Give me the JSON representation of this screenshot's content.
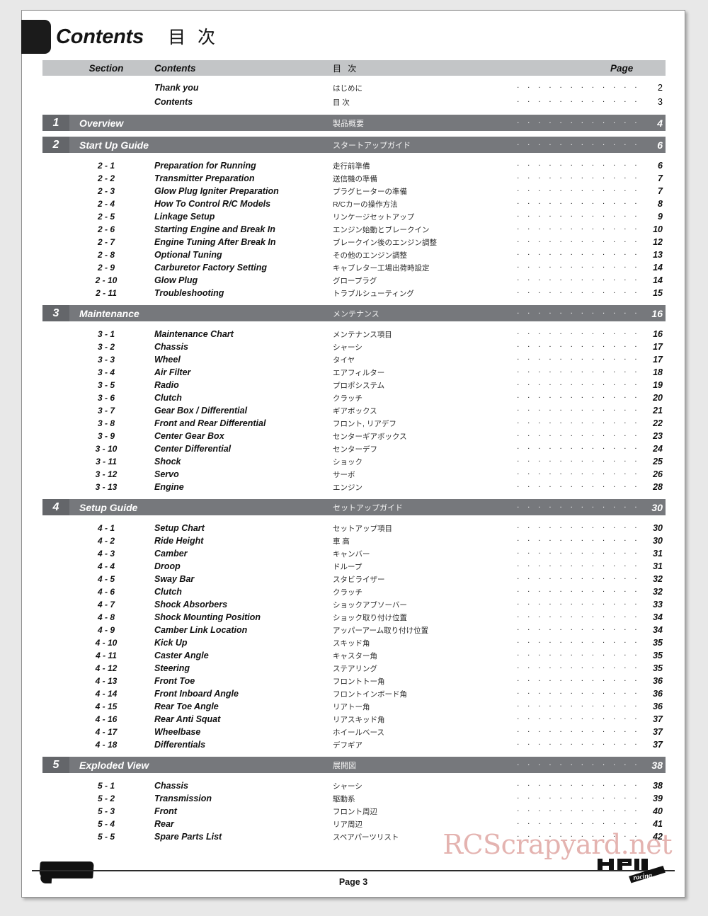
{
  "document": {
    "title_en": "Contents",
    "title_jp": "目 次"
  },
  "table": {
    "headers": {
      "section": "Section",
      "contents": "Contents",
      "contents_jp": "目 次",
      "page": "Page"
    },
    "front_matter": [
      {
        "title": "Thank you",
        "jp": "はじめに",
        "page": "2"
      },
      {
        "title": "Contents",
        "jp": "目 次",
        "page": "3"
      }
    ],
    "sections": [
      {
        "number": "1",
        "title": "Overview",
        "jp": "製品概要",
        "page": "4",
        "items": []
      },
      {
        "number": "2",
        "title": "Start Up Guide",
        "jp": "スタートアップガイド",
        "page": "6",
        "items": [
          {
            "sec": "2 - 1",
            "title": "Preparation for Running",
            "jp": "走行前準備",
            "page": "6"
          },
          {
            "sec": "2 - 2",
            "title": "Transmitter Preparation",
            "jp": "送信機の準備",
            "page": "7"
          },
          {
            "sec": "2 - 3",
            "title": "Glow Plug Igniter Preparation",
            "jp": "プラグヒーターの準備",
            "page": "7"
          },
          {
            "sec": "2 - 4",
            "title": "How To Control R/C Models",
            "jp": "R/Cカーの操作方法",
            "page": "8"
          },
          {
            "sec": "2 - 5",
            "title": "Linkage Setup",
            "jp": "リンケージセットアップ",
            "page": "9"
          },
          {
            "sec": "2 - 6",
            "title": "Starting Engine and Break In",
            "jp": "エンジン始動とブレークイン",
            "page": "10"
          },
          {
            "sec": "2 - 7",
            "title": "Engine Tuning After Break In",
            "jp": "ブレークイン後のエンジン調整",
            "page": "12"
          },
          {
            "sec": "2 - 8",
            "title": "Optional Tuning",
            "jp": "その他のエンジン調整",
            "page": "13"
          },
          {
            "sec": "2 - 9",
            "title": "Carburetor Factory Setting",
            "jp": "キャブレター工場出荷時設定",
            "page": "14"
          },
          {
            "sec": "2 - 10",
            "title": "Glow Plug",
            "jp": "グロープラグ",
            "page": "14"
          },
          {
            "sec": "2 - 11",
            "title": "Troubleshooting",
            "jp": "トラブルシューティング",
            "page": "15"
          }
        ]
      },
      {
        "number": "3",
        "title": "Maintenance",
        "jp": "メンテナンス",
        "page": "16",
        "items": [
          {
            "sec": "3 - 1",
            "title": "Maintenance Chart",
            "jp": "メンテナンス項目",
            "page": "16"
          },
          {
            "sec": "3 - 2",
            "title": "Chassis",
            "jp": "シャーシ",
            "page": "17"
          },
          {
            "sec": "3 - 3",
            "title": "Wheel",
            "jp": "タイヤ",
            "page": "17"
          },
          {
            "sec": "3 - 4",
            "title": "Air Filter",
            "jp": "エアフィルター",
            "page": "18"
          },
          {
            "sec": "3 - 5",
            "title": "Radio",
            "jp": "プロポシステム",
            "page": "19"
          },
          {
            "sec": "3 - 6",
            "title": "Clutch",
            "jp": "クラッチ",
            "page": "20"
          },
          {
            "sec": "3 - 7",
            "title": "Gear Box / Differential",
            "jp": "ギアボックス",
            "page": "21"
          },
          {
            "sec": "3 - 8",
            "title": "Front and Rear Differential",
            "jp": "フロント, リアデフ",
            "page": "22"
          },
          {
            "sec": "3 - 9",
            "title": "Center Gear Box",
            "jp": "センターギアボックス",
            "page": "23"
          },
          {
            "sec": "3 - 10",
            "title": "Center Differential",
            "jp": "センターデフ",
            "page": "24"
          },
          {
            "sec": "3 - 11",
            "title": "Shock",
            "jp": "ショック",
            "page": "25"
          },
          {
            "sec": "3 - 12",
            "title": "Servo",
            "jp": "サーボ",
            "page": "26"
          },
          {
            "sec": "3 - 13",
            "title": "Engine",
            "jp": "エンジン",
            "page": "28"
          }
        ]
      },
      {
        "number": "4",
        "title": "Setup Guide",
        "jp": "セットアップガイド",
        "page": "30",
        "items": [
          {
            "sec": "4 - 1",
            "title": "Setup Chart",
            "jp": "セットアップ項目",
            "page": "30"
          },
          {
            "sec": "4 - 2",
            "title": "Ride Height",
            "jp": "車 高",
            "page": "30"
          },
          {
            "sec": "4 - 3",
            "title": "Camber",
            "jp": "キャンバー",
            "page": "31"
          },
          {
            "sec": "4 - 4",
            "title": "Droop",
            "jp": "ドループ",
            "page": "31"
          },
          {
            "sec": "4 - 5",
            "title": "Sway Bar",
            "jp": "スタビライザー",
            "page": "32"
          },
          {
            "sec": "4 - 6",
            "title": "Clutch",
            "jp": "クラッチ",
            "page": "32"
          },
          {
            "sec": "4 - 7",
            "title": "Shock Absorbers",
            "jp": "ショックアブソーバー",
            "page": "33"
          },
          {
            "sec": "4 - 8",
            "title": "Shock Mounting Position",
            "jp": "ショック取り付け位置",
            "page": "34"
          },
          {
            "sec": "4 - 9",
            "title": "Camber Link Location",
            "jp": "アッパーアーム取り付け位置",
            "page": "34"
          },
          {
            "sec": "4 - 10",
            "title": "Kick Up",
            "jp": "スキッド角",
            "page": "35"
          },
          {
            "sec": "4 - 11",
            "title": "Caster Angle",
            "jp": "キャスター角",
            "page": "35"
          },
          {
            "sec": "4 - 12",
            "title": "Steering",
            "jp": "ステアリング",
            "page": "35"
          },
          {
            "sec": "4 - 13",
            "title": "Front Toe",
            "jp": "フロントトー角",
            "page": "36"
          },
          {
            "sec": "4 - 14",
            "title": "Front Inboard Angle",
            "jp": "フロントインボード角",
            "page": "36"
          },
          {
            "sec": "4 - 15",
            "title": "Rear Toe Angle",
            "jp": "リアトー角",
            "page": "36"
          },
          {
            "sec": "4 - 16",
            "title": "Rear Anti Squat",
            "jp": "リアスキッド角",
            "page": "37"
          },
          {
            "sec": "4 - 17",
            "title": "Wheelbase",
            "jp": "ホイールベース",
            "page": "37"
          },
          {
            "sec": "4 - 18",
            "title": "Differentials",
            "jp": "デフギア",
            "page": "37"
          }
        ]
      },
      {
        "number": "5",
        "title": "Exploded View",
        "jp": "展開図",
        "page": "38",
        "items": [
          {
            "sec": "5 - 1",
            "title": "Chassis",
            "jp": "シャーシ",
            "page": "38"
          },
          {
            "sec": "5 - 2",
            "title": "Transmission",
            "jp": "駆動系",
            "page": "39"
          },
          {
            "sec": "5 - 3",
            "title": "Front",
            "jp": "フロント周辺",
            "page": "40"
          },
          {
            "sec": "5 - 4",
            "title": "Rear",
            "jp": "リア周辺",
            "page": "41"
          },
          {
            "sec": "5 - 5",
            "title": "Spare Parts List",
            "jp": "スペアパーツリスト",
            "page": "42"
          }
        ]
      }
    ]
  },
  "footer": {
    "page_label": "Page 3",
    "watermark": "RCScrapyard.net",
    "logo_primary": "HPI",
    "logo_secondary": "racing"
  },
  "colors": {
    "section_bar": "#76787c",
    "section_number_box": "#64666a",
    "table_header": "#c3c5c7",
    "watermark": "#e0a6a3",
    "page_background": "#e8e8e8",
    "sheet": "#ffffff"
  }
}
